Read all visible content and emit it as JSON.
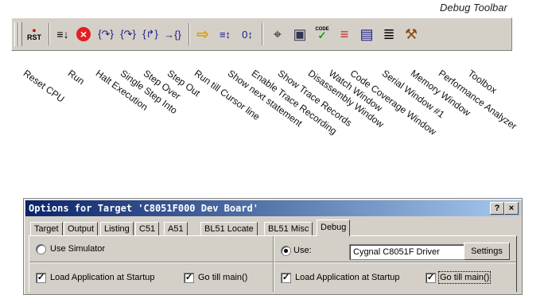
{
  "toolbar": {
    "caption": "Debug Toolbar",
    "buttons": [
      {
        "label": "Reset CPU",
        "icon": "reset-cpu-icon",
        "glyph": "RST"
      },
      {
        "label": "Run",
        "icon": "run-icon",
        "glyph": "≡↓"
      },
      {
        "label": "Halt Execution",
        "icon": "halt-icon",
        "glyph": "×"
      },
      {
        "label": "Single Step Into",
        "icon": "step-into-icon",
        "glyph": "{↷}"
      },
      {
        "label": "Step Over",
        "icon": "step-over-icon",
        "glyph": "{↷}"
      },
      {
        "label": "Step Out",
        "icon": "step-out-icon",
        "glyph": "{↱}"
      },
      {
        "label": "Run till Cursor line",
        "icon": "run-to-cursor-icon",
        "glyph": "→{}"
      },
      {
        "label": "Show next statement",
        "icon": "show-next-statement-icon",
        "glyph": "⇨"
      },
      {
        "label": "Enable Trace Recording",
        "icon": "trace-recording-icon",
        "glyph": "≡↕"
      },
      {
        "label": "Show Trace Records",
        "icon": "trace-records-icon",
        "glyph": "0↕"
      },
      {
        "label": "Disassembly Window",
        "icon": "disassembly-icon",
        "glyph": "⌖"
      },
      {
        "label": "Watch Window",
        "icon": "watch-icon",
        "glyph": "▣"
      },
      {
        "label": "Code Coverage Window",
        "icon": "code-coverage-icon",
        "glyph": "CODE"
      },
      {
        "label": "Serial Window #1",
        "icon": "serial-window-icon",
        "glyph": "≡"
      },
      {
        "label": "Memory Window",
        "icon": "memory-window-icon",
        "glyph": "▤"
      },
      {
        "label": "Performance Analyzer",
        "icon": "performance-analyzer-icon",
        "glyph": "≣"
      },
      {
        "label": "Toolbox",
        "icon": "toolbox-icon",
        "glyph": "⚒"
      }
    ]
  },
  "dialog": {
    "title": "Options for Target 'C8051F000 Dev Board'",
    "help_glyph": "?",
    "close_glyph": "×",
    "tabs": [
      "Target",
      "Output",
      "Listing",
      "C51",
      "A51",
      "BL51 Locate",
      "BL51 Misc",
      "Debug"
    ],
    "active_tab": "Debug",
    "left": {
      "use_simulator": "Use Simulator",
      "load_app": "Load Application at Startup",
      "go_till_main": "Go till main()"
    },
    "right": {
      "use": "Use:",
      "driver": "Cygnal C8051F Driver",
      "settings": "Settings",
      "load_app": "Load Application at Startup",
      "go_till_main": "Go till main()"
    },
    "check_glyph": "✓"
  }
}
